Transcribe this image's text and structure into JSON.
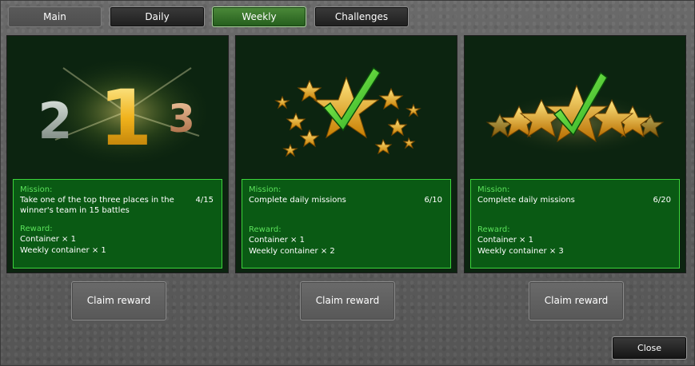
{
  "tabs": [
    {
      "label": "Main"
    },
    {
      "label": "Daily"
    },
    {
      "label": "Weekly"
    },
    {
      "label": "Challenges"
    }
  ],
  "active_tab": "Weekly",
  "cards": [
    {
      "icon": "podium-213-icon",
      "podium_digits": [
        "2",
        "1",
        "3"
      ],
      "mission_label": "Mission:",
      "mission_text": "Take one of the top three places in the winner's team in 15 battles",
      "progress": "4/15",
      "reward_label": "Reward:",
      "rewards": [
        "Container × 1",
        "Weekly container × 1"
      ],
      "claim_label": "Claim reward"
    },
    {
      "icon": "stars-checkmark-icon",
      "mission_label": "Mission:",
      "mission_text": "Complete daily missions",
      "progress": "6/10",
      "reward_label": "Reward:",
      "rewards": [
        "Container × 1",
        "Weekly container × 2"
      ],
      "claim_label": "Claim reward"
    },
    {
      "icon": "star-row-checkmark-icon",
      "mission_label": "Mission:",
      "mission_text": "Complete daily missions",
      "progress": "6/20",
      "reward_label": "Reward:",
      "rewards": [
        "Container × 1",
        "Weekly container × 3"
      ],
      "claim_label": "Claim reward"
    }
  ],
  "close_label": "Close",
  "colors": {
    "mission_bg": "#0a5a14",
    "mission_border": "#3bd53b",
    "label_green": "#5be25b",
    "card_bg": "#0c2410",
    "tab_active": "#3f7a32"
  }
}
